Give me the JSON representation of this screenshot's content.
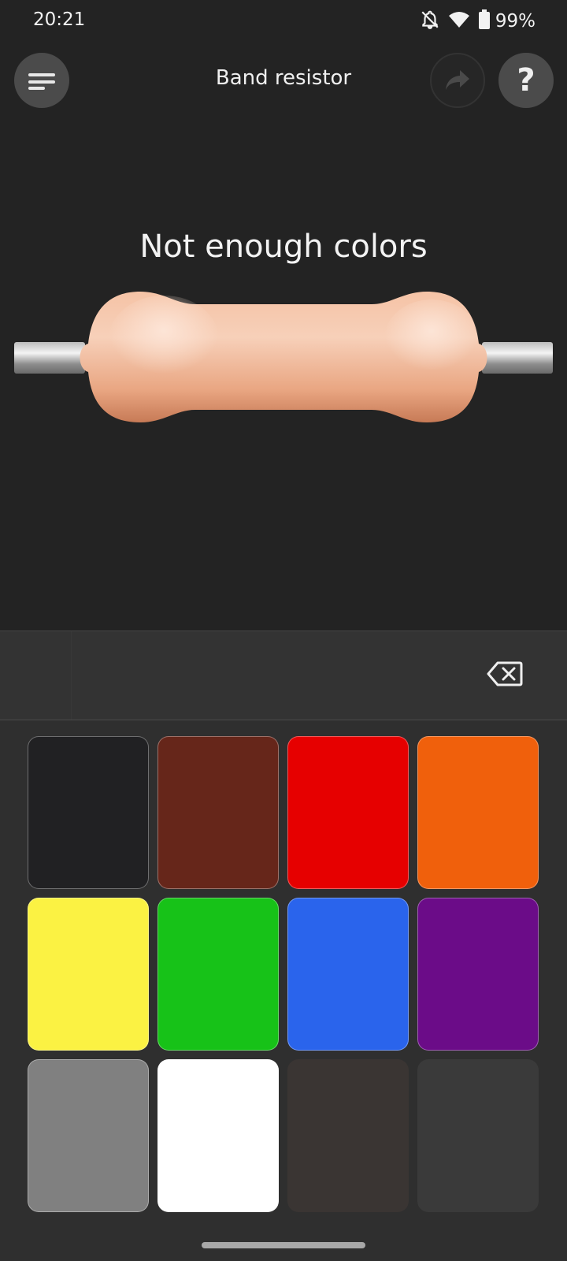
{
  "status": {
    "time": "20:21",
    "battery": "99%",
    "icons": [
      "notifications-off-icon",
      "wifi-icon",
      "battery-icon"
    ]
  },
  "header": {
    "title": "Band resistor",
    "menu_icon": "menu-icon",
    "share_icon": "share-icon",
    "help_icon": "help-icon"
  },
  "main": {
    "message": "Not enough colors"
  },
  "input": {
    "backspace_icon": "backspace-icon"
  },
  "palette": {
    "colors": [
      {
        "name": "black",
        "hex": "#212123"
      },
      {
        "name": "brown",
        "hex": "#66261a"
      },
      {
        "name": "red",
        "hex": "#e60000"
      },
      {
        "name": "orange",
        "hex": "#f0600c"
      },
      {
        "name": "yellow",
        "hex": "#fbf243"
      },
      {
        "name": "green",
        "hex": "#17c218"
      },
      {
        "name": "blue",
        "hex": "#2a64ec"
      },
      {
        "name": "violet",
        "hex": "#6b0c88"
      },
      {
        "name": "gray",
        "hex": "#808080"
      },
      {
        "name": "white",
        "hex": "#ffffff"
      },
      {
        "name": "gold",
        "hex": "#3a3533"
      },
      {
        "name": "silver",
        "hex": "#3a3a3a"
      }
    ]
  }
}
